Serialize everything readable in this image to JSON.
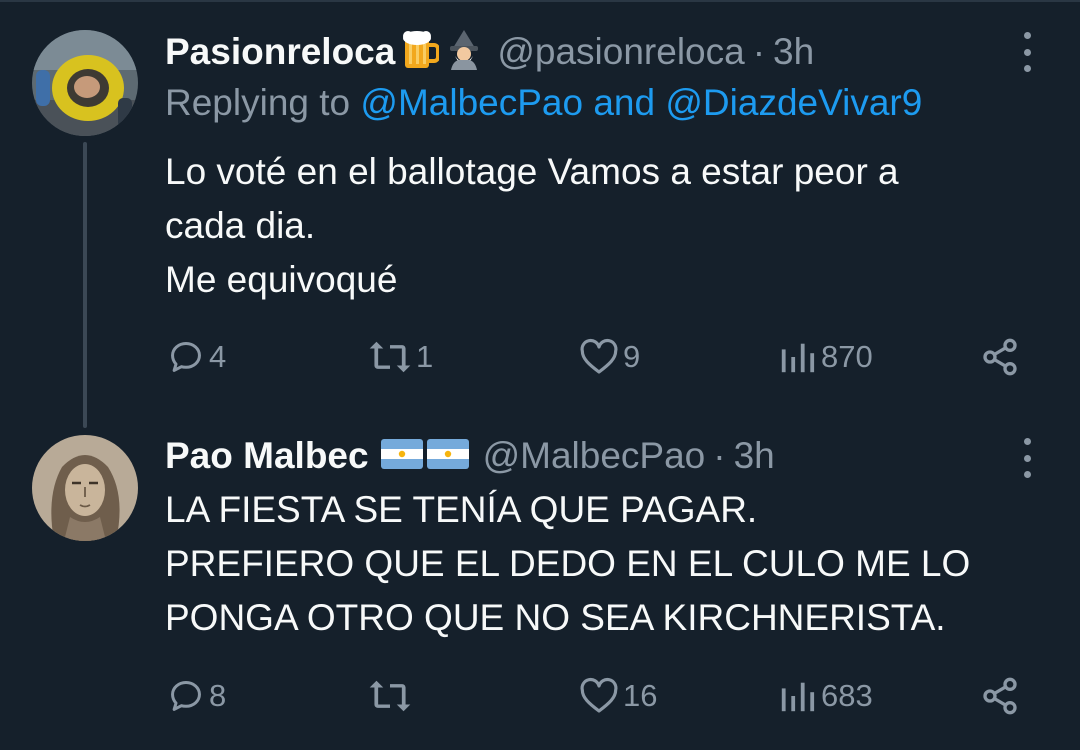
{
  "tweets": [
    {
      "display_name": "Pasionreloca",
      "name_emojis": [
        "beer-mug-emoji",
        "mage-emoji"
      ],
      "handle": "@pasionreloca",
      "dot": "·",
      "time": "3h",
      "replying_prefix": "Replying to ",
      "replying_to_1": "@MalbecPao",
      "replying_and": " and ",
      "replying_to_2": "@DiazdeVivar9",
      "text_lines": [
        "Lo voté en el ballotage Vamos a estar peor a",
        "cada dia.",
        "Me equivoqué"
      ],
      "replies": "4",
      "retweets": "1",
      "likes": "9",
      "views": "870"
    },
    {
      "display_name": "Pao Malbec",
      "name_emojis": [
        "argentina-flag-emoji",
        "argentina-flag-emoji"
      ],
      "handle": "@MalbecPao",
      "dot": "·",
      "time": "3h",
      "text_lines": [
        "LA FIESTA SE TENÍA QUE PAGAR.",
        "PREFIERO QUE EL DEDO EN EL CULO ME LO",
        "PONGA OTRO QUE NO SEA KIRCHNERISTA."
      ],
      "replies": "8",
      "retweets": "",
      "likes": "16",
      "views": "683"
    }
  ],
  "colors": {
    "background": "#15202b",
    "text": "#f7f9f9",
    "secondary": "#8b98a5",
    "link": "#1d9bf0",
    "thread_line": "#3b4855"
  }
}
